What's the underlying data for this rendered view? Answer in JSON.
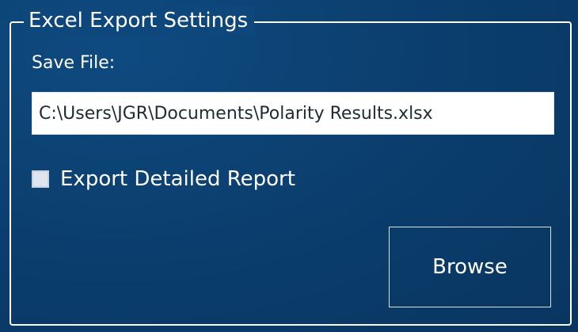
{
  "groupbox": {
    "title": "Excel Export Settings"
  },
  "save_file": {
    "label": "Save File:",
    "value": "C:\\Users\\JGR\\Documents\\Polarity Results.xlsx"
  },
  "export_detailed": {
    "label": "Export Detailed Report",
    "checked": false
  },
  "browse": {
    "label": "Browse"
  },
  "colors": {
    "background": "#0b3f6f",
    "foreground": "#ffffff"
  }
}
